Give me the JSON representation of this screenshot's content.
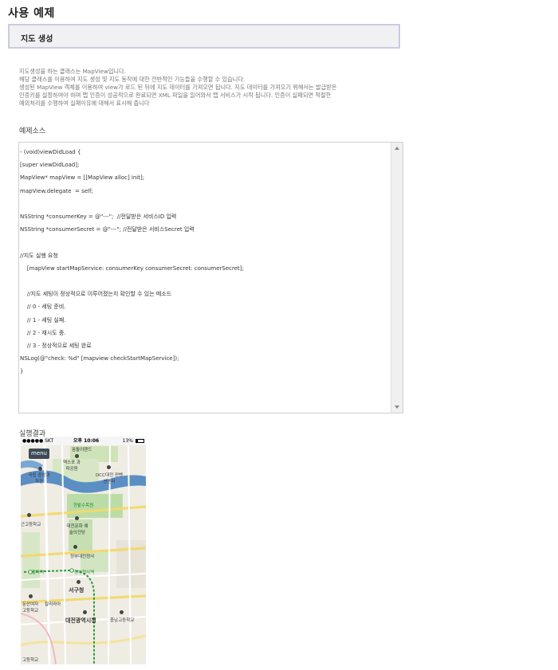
{
  "page": {
    "title": "사용 예제"
  },
  "section": {
    "title": "지도 생성"
  },
  "description": [
    "지도생성을 하는 클래스는 MapView입니다.",
    "해당 클래스를 이용하여 지도 생성 및 지도 동작에 대한 전반적인 기능들을 수행할 수 있습니다.",
    "생성된 MapView 객체를 이용하여 view가 로드 된 뒤에 지도 데이터를 가져오면 됩니다. 지도 데이터를 가져오기 위해서는 발급받은",
    "인증키를 설정하여야 하며 맵 인증이 성공적으로 완료되면 XML 파일을 읽어와서 맵 서비스가 시작 됩니다. 인증이 실패되면 적절한",
    "예외처리를 수행하여 실패이유에 대해서 표시해 줍니다"
  ],
  "source": {
    "label": "예제소스",
    "lines": [
      "- (void)viewDidLoad {",
      "[super viewDidLoad];",
      "MapView* mapView = [[MapView alloc] init];",
      "mapView.delegate  = self;",
      "",
      "NSString *consumerKey = @\"---\";  //전달받은 서비스ID 입력",
      "NSString *consumerSecret = @\"---\"; //전달받은 서비스Secret 입력",
      "",
      "//지도 실행 요청",
      "    [mapView startMapService: consumerKey consumerSecret: consumerSecret];",
      "",
      "    //지도 세팅이 정상적으로 이루어졌는지 확인할 수 있는 메소드",
      "    // 0 - 세팅 준비.",
      "    // 1 - 세팅 실패.",
      "    // 2 - 재시도 중.",
      "    // 3 - 정상적으로 세팅 완료",
      "NSLog(@\"check: %d\" [mapview checkStartMapService]);",
      "}"
    ]
  },
  "result": {
    "label": "실행결과",
    "status": {
      "carrier": "●●●●● SKT",
      "time": "오후 10:06",
      "battery": "13%"
    },
    "menu_label": "menu",
    "map_labels": [
      "꿈돌이랜드",
      "엑스포 과학공원",
      "국립 중앙과학관",
      "DCC대전 컨벤션센터",
      "한밭수목원",
      "대전문화 예술의전당",
      "정부대전청사",
      "갈마역",
      "정부청사역",
      "서구청",
      "대전광역시청",
      "충남고등학교",
      "칼리라아",
      "둔산여자 고등학교",
      "고등학교",
      "근고등학교"
    ],
    "colors": {
      "river": "#5b8fc4",
      "park": "#b8d9a0",
      "road": "#f3d96b",
      "subway": "#2e9b3a"
    }
  }
}
